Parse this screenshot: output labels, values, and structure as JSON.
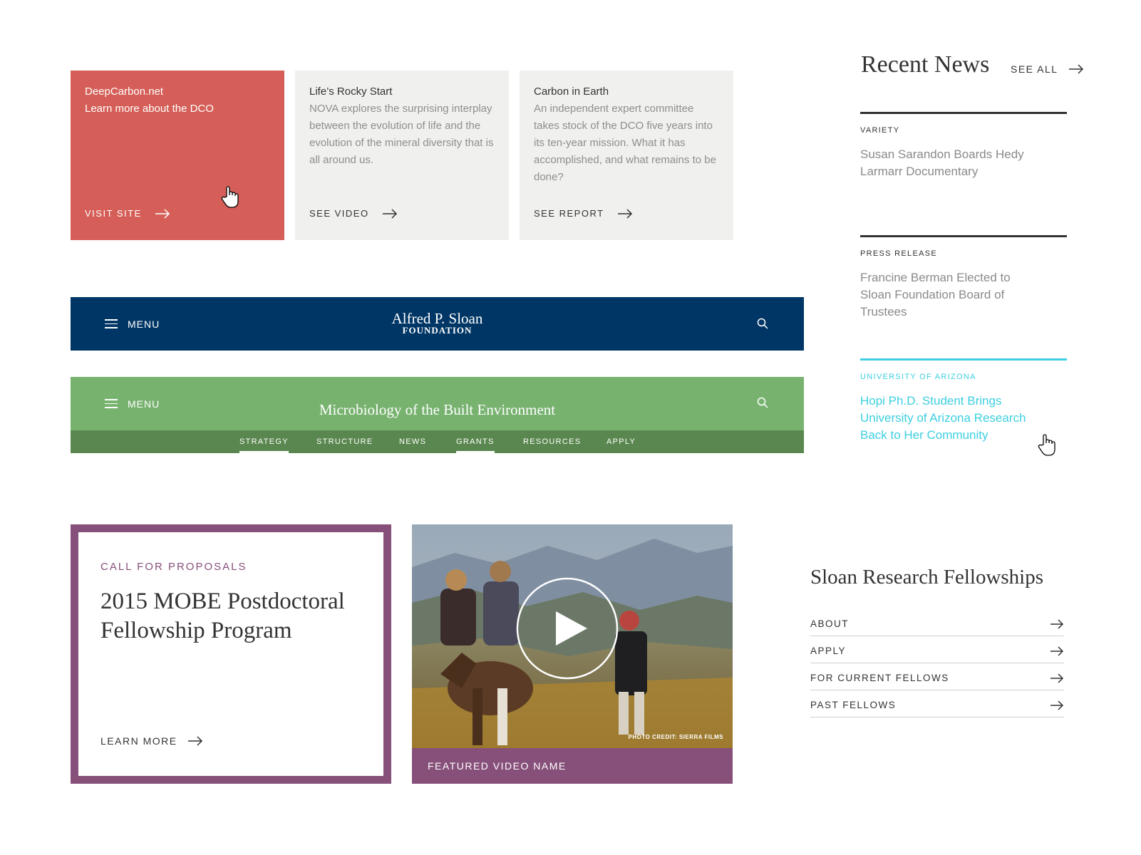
{
  "cards": [
    {
      "title": "DeepCarbon.net",
      "desc": "Learn more about the DCO",
      "action": "VISIT SITE"
    },
    {
      "title": "Life’s Rocky Start",
      "desc": "NOVA explores the surprising interplay between the evolution of life and the evolution of the mineral diversity that is all around us.",
      "action": "SEE VIDEO"
    },
    {
      "title": "Carbon in Earth",
      "desc": "An independent expert committee takes stock of the DCO five years into its ten-year mission.  What it has accomplished, and what remains to be done?",
      "action": "SEE REPORT"
    }
  ],
  "sloan_nav": {
    "menu_label": "MENU",
    "logo_line1": "Alfred P. Sloan",
    "logo_line2": "FOUNDATION",
    "search_icon": "search-icon",
    "background": "#003665"
  },
  "mobe_nav": {
    "menu_label": "MENU",
    "title": "Microbiology of the Built Environment",
    "background": "#77b26f",
    "subnav_background": "#5a874f",
    "items": [
      {
        "label": "STRATEGY",
        "active": true
      },
      {
        "label": "STRUCTURE",
        "active": false
      },
      {
        "label": "NEWS",
        "active": false
      },
      {
        "label": "GRANTS",
        "active": true
      },
      {
        "label": "RESOURCES",
        "active": false
      },
      {
        "label": "APPLY",
        "active": false
      }
    ]
  },
  "recent_news": {
    "title": "Recent News",
    "see_all": "SEE ALL",
    "items": [
      {
        "source": "VARIETY",
        "headline": "Susan Sarandon Boards Hedy Larmarr Documentary"
      },
      {
        "source": "PRESS RELEASE",
        "headline": "Francine Berman Elected to Sloan Foundation Board of Trustees"
      },
      {
        "source": "UNIVERSITY OF ARIZONA",
        "headline": "Hopi Ph.D. Student Brings University of Arizona Research Back to Her Community",
        "hover_color": "#3ccfe0"
      }
    ]
  },
  "call_for_proposals": {
    "label": "CALL FOR PROPOSALS",
    "title": "2015 MOBE Postdoctoral Fellowship Program",
    "action": "LEARN MORE",
    "accent": "#87507a"
  },
  "video": {
    "photo_credit": "PHOTO CREDIT: SIERRA FILMS",
    "caption": "FEATURED VIDEO NAME",
    "play_icon": "play-icon"
  },
  "fellowships": {
    "title": "Sloan Research Fellowships",
    "items": [
      "ABOUT",
      "APPLY",
      "FOR CURRENT FELLOWS",
      "PAST FELLOWS"
    ]
  },
  "colors": {
    "card_red": "#d55f58",
    "card_grey": "#f0f0ee",
    "text_dark": "#333333",
    "text_muted": "#8a8a8a"
  }
}
